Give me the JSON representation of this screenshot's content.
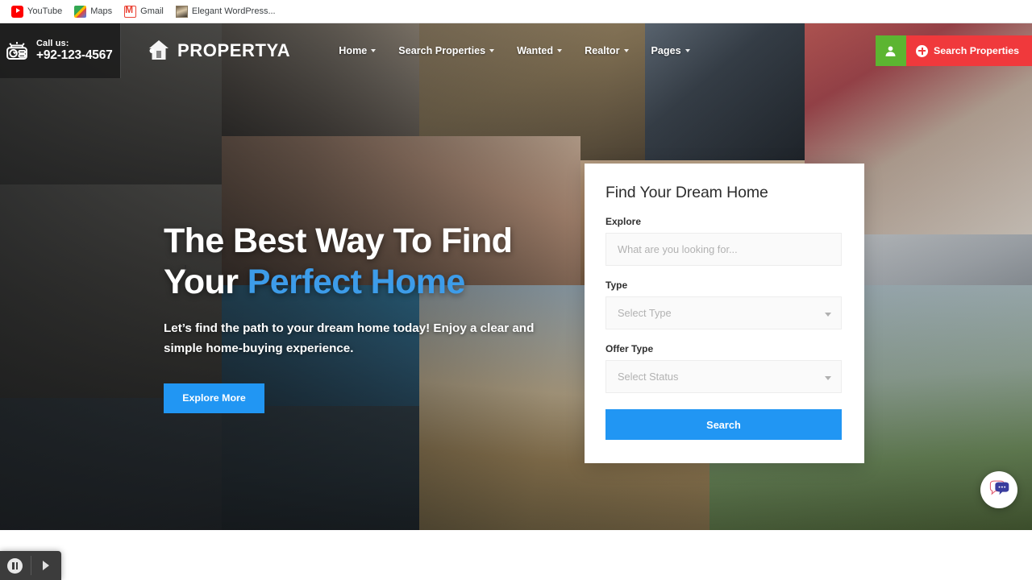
{
  "browser": {
    "bookmarks": [
      {
        "label": "YouTube",
        "icon": "youtube-icon"
      },
      {
        "label": "Maps",
        "icon": "maps-icon"
      },
      {
        "label": "Gmail",
        "icon": "gmail-icon"
      },
      {
        "label": "Elegant WordPress...",
        "icon": "wordpress-thumbnail-icon"
      }
    ]
  },
  "topbar": {
    "call_label": "Call us:",
    "phone": "+92-123-4567",
    "brand": "PROPERTYA",
    "nav": [
      {
        "label": "Home"
      },
      {
        "label": "Search Properties"
      },
      {
        "label": "Wanted"
      },
      {
        "label": "Realtor"
      },
      {
        "label": "Pages"
      }
    ],
    "search_properties_button": "Search Properties"
  },
  "hero": {
    "title_line1": "The Best Way To Find",
    "title_line2_plain": "Your ",
    "title_line2_accent": "Perfect Home",
    "subtitle": "Let’s find the path to your dream home today! Enjoy a clear and simple home-buying experience.",
    "cta": "Explore More"
  },
  "search_card": {
    "title": "Find Your Dream Home",
    "explore_label": "Explore",
    "explore_placeholder": "What are you looking for...",
    "explore_value": "",
    "type_label": "Type",
    "type_value": "Select Type",
    "offer_label": "Offer Type",
    "offer_value": "Select Status",
    "search_button": "Search"
  },
  "colors": {
    "accent_blue": "#2196f3",
    "heading_accent_blue": "#3d9ce9",
    "red_button": "#f0393c",
    "green_button": "#5cb531",
    "topbar_dark": "#1c1c1c"
  }
}
